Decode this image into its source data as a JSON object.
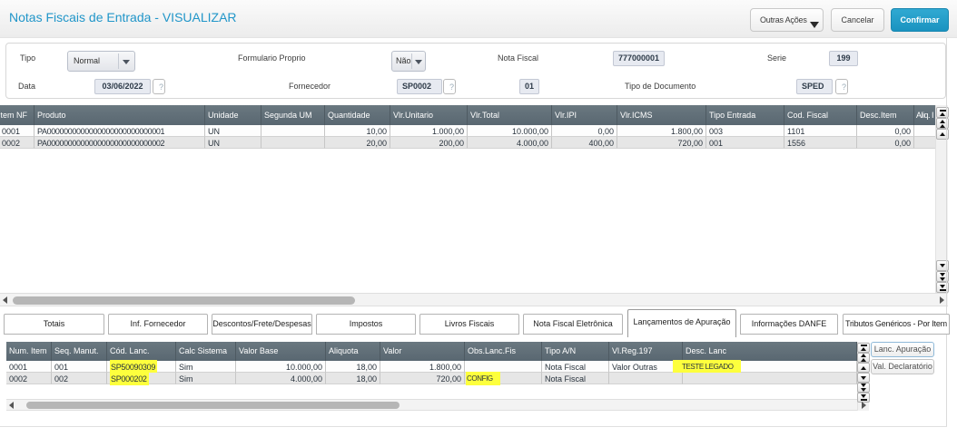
{
  "header": {
    "title": "Notas Fiscais de Entrada - VISUALIZAR",
    "buttons": {
      "other_actions": "Outras Ações",
      "cancel": "Cancelar",
      "confirm": "Confirmar"
    }
  },
  "form": {
    "tipo": {
      "label": "Tipo",
      "value": "Normal"
    },
    "formulario": {
      "label": "Formulario Proprio",
      "value": "Não"
    },
    "nota_fiscal": {
      "label": "Nota Fiscal",
      "value": "777000001"
    },
    "serie": {
      "label": "Serie",
      "value": "199"
    },
    "data": {
      "label": "Data",
      "value": "03/06/2022",
      "help": "?"
    },
    "fornecedor": {
      "label": "Fornecedor",
      "value": "SP0002",
      "help": "?"
    },
    "loja": {
      "value": "01"
    },
    "tipo_doc": {
      "label": "Tipo de Documento",
      "value": "SPED",
      "help": "?"
    }
  },
  "top_grid": {
    "columns": [
      "Item NF",
      "Produto",
      "Unidade",
      "Segunda UM",
      "Quantidade",
      "Vlr.Unitario",
      "Vlr.Total",
      "Vlr.IPI",
      "Vlr.ICMS",
      "Tipo Entrada",
      "Cod. Fiscal",
      "Desc.Item",
      "Aliq. I"
    ],
    "rows": [
      [
        "0001",
        "PA0000000000000000000000000001",
        "UN",
        "",
        "10,00",
        "1.000,00",
        "10.000,00",
        "0,00",
        "1.800,00",
        "003",
        "1101",
        "0,00",
        ""
      ],
      [
        "0002",
        "PA0000000000000000000000000002",
        "UN",
        "",
        "20,00",
        "200,00",
        "4.000,00",
        "400,00",
        "720,00",
        "001",
        "1556",
        "0,00",
        ""
      ]
    ]
  },
  "tabs": {
    "items": [
      {
        "label": "Totais"
      },
      {
        "label": "Inf. Fornecedor"
      },
      {
        "label": "Descontos/Frete/Despesas"
      },
      {
        "label": "Impostos"
      },
      {
        "label": "Livros Fiscais"
      },
      {
        "label": "Nota Fiscal Eletrônica"
      },
      {
        "label": "Lançamentos de Apuração"
      },
      {
        "label": "Informações DANFE"
      },
      {
        "label": "Tributos Genéricos - Por Item"
      }
    ],
    "active": "Lançamentos de Apuração"
  },
  "bottom_grid": {
    "columns": [
      "Num. Item",
      "Seq. Manut.",
      "Cód. Lanc.",
      "Calc Sistema",
      "Valor Base",
      "Aliquota",
      "Valor",
      "Obs.Lanc.Fis",
      "Tipo A/N",
      "Vl.Reg.197",
      "Desc. Lanc"
    ],
    "rows": [
      [
        "0001",
        "001",
        "SP50090309",
        "Sim",
        "10.000,00",
        "18,00",
        "1.800,00",
        "",
        "Nota Fiscal",
        "Valor Outras",
        "TESTE LEGADO"
      ],
      [
        "0002",
        "002",
        "SP000202",
        "Sim",
        "4.000,00",
        "18,00",
        "720,00",
        "CONFIG",
        "Nota Fiscal",
        "",
        ""
      ]
    ],
    "highlight_color": "#fdff3d"
  },
  "side_buttons": {
    "lanc_apuracao": "Lanc. Apuração",
    "val_declaratorio": "Val. Declaratório"
  },
  "icons": {
    "chevron-down-icon": "▼",
    "combo-arrow-icon": "▼",
    "help-icon": "?",
    "scroll-first-icon": "⤒",
    "scroll-page-up-icon": "⇈",
    "scroll-up-icon": "▲",
    "scroll-down-icon": "▼",
    "scroll-page-down-icon": "⇊",
    "scroll-last-icon": "⤓",
    "scroll-left-icon": "◀",
    "scroll-right-icon": "▶"
  }
}
